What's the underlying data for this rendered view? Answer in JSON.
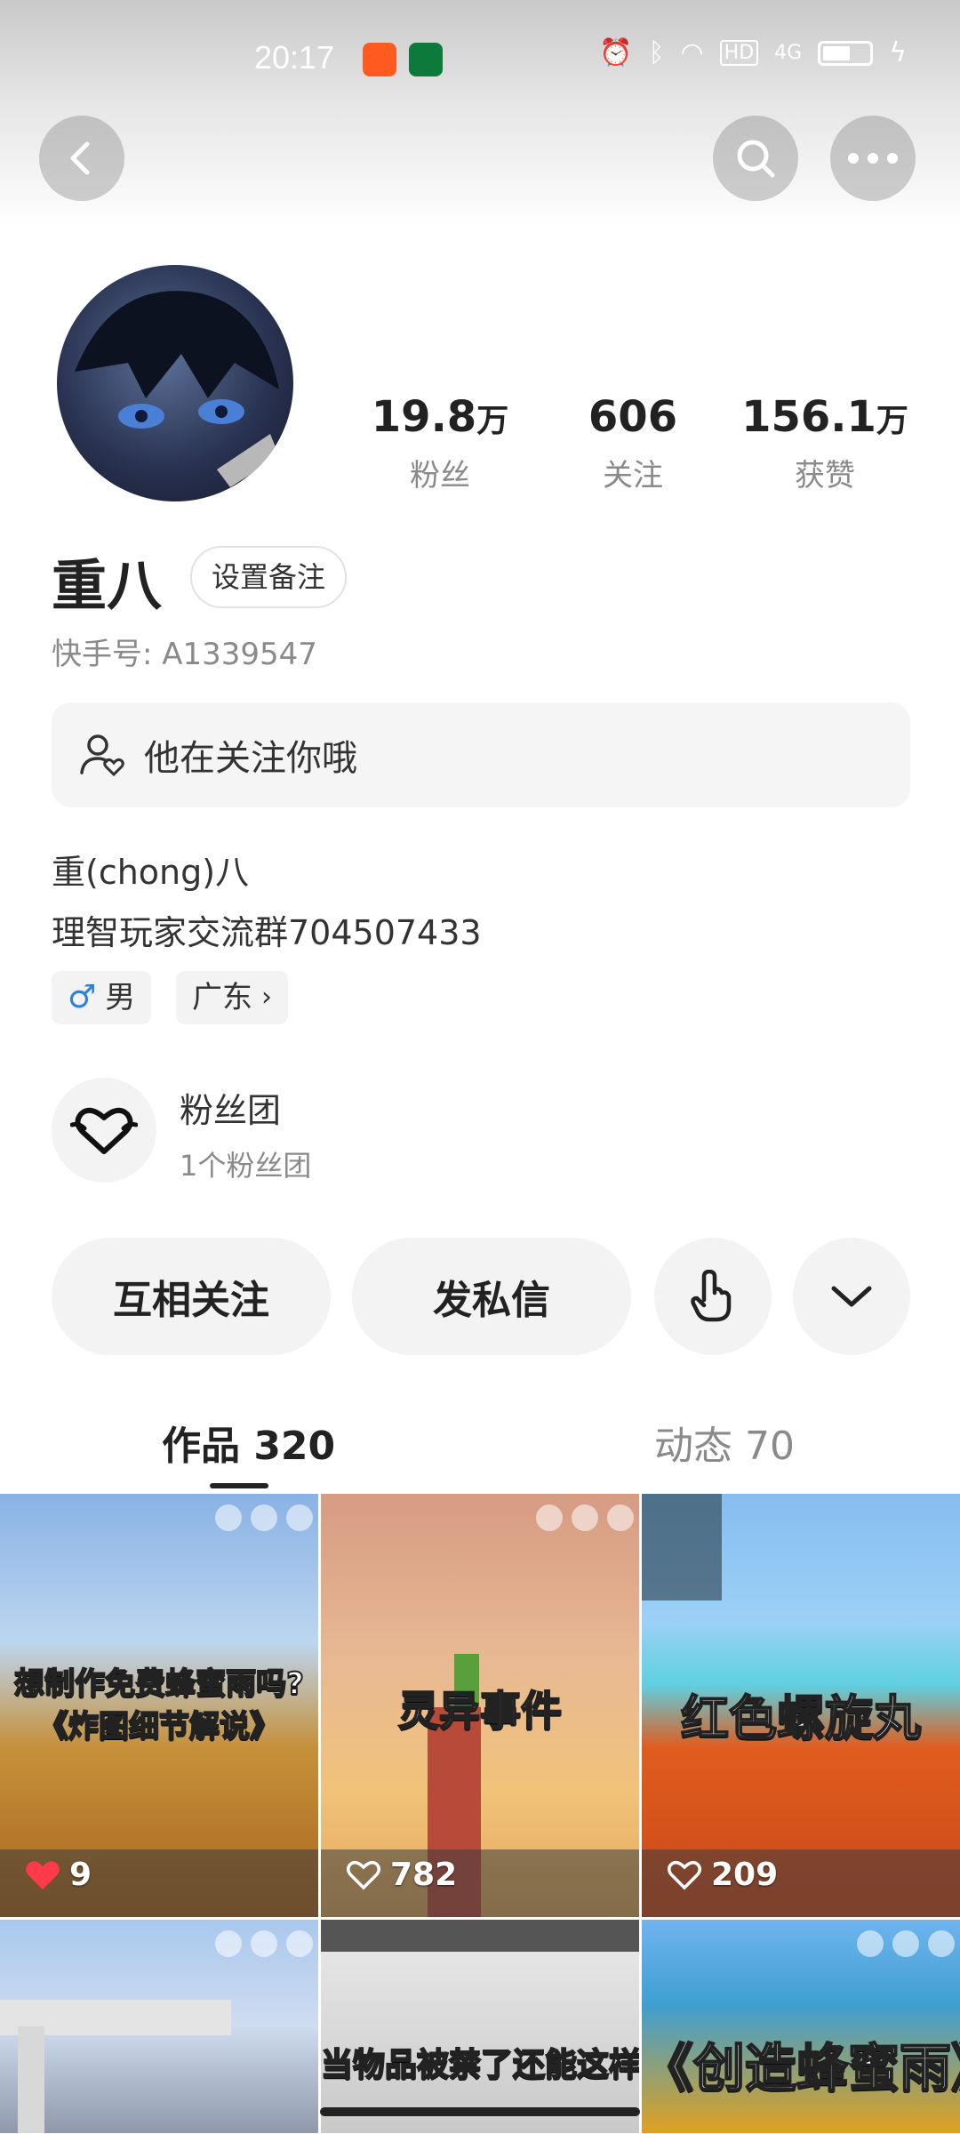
{
  "status_bar": {
    "time": "20:17",
    "network": "4G",
    "hd": "HD"
  },
  "profile": {
    "username": "重八",
    "note_button": "设置备注",
    "kuaishou_id": "快手号: A1339547",
    "stats": [
      {
        "number": "19.8",
        "unit": "万",
        "label": "粉丝"
      },
      {
        "number": "606",
        "unit": "",
        "label": "关注"
      },
      {
        "number": "156.1",
        "unit": "万",
        "label": "获赞"
      }
    ],
    "follow_notice": "他在关注你哦",
    "bio_lines": [
      "重(chong)八",
      "理智玩家交流群704507433"
    ],
    "gender": "男",
    "region": "广东",
    "fan_club": {
      "title": "粉丝团",
      "subtitle": "1个粉丝团"
    }
  },
  "actions": {
    "mutual_follow": "互相关注",
    "message": "发私信"
  },
  "tabs": [
    {
      "label": "作品 320",
      "active": true
    },
    {
      "label": "动态 70",
      "active": false
    }
  ],
  "videos": [
    {
      "title": "想制作免费蜂蜜雨吗?《炸图细节解说》",
      "likes": "9",
      "liked": true
    },
    {
      "title": "灵异事件",
      "likes": "782",
      "liked": false
    },
    {
      "title": "红色螺旋丸",
      "likes": "209",
      "liked": false
    },
    {
      "title": "",
      "likes": "",
      "liked": false
    },
    {
      "title": "当物品被禁了还能这样",
      "likes": "",
      "liked": false
    },
    {
      "title": "《创造蜂蜜雨》",
      "likes": "",
      "liked": false
    }
  ],
  "colors": {
    "accent_red": "#ff3b4a",
    "chip_bg": "#f3f3f3",
    "muted_text": "#8a8a8a",
    "male_blue": "#2f7fe0"
  }
}
